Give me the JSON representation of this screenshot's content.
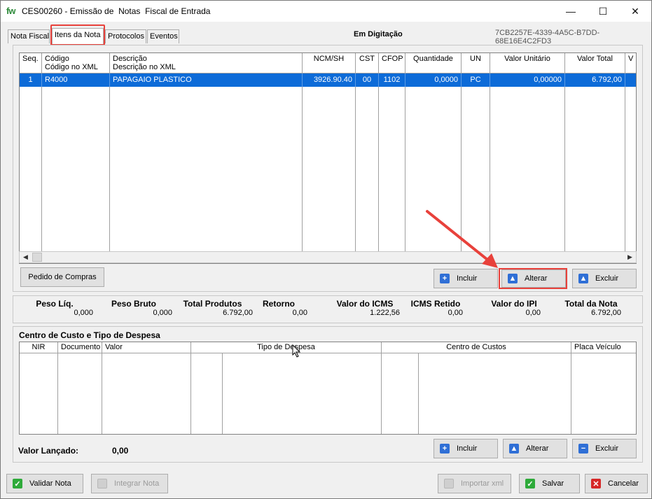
{
  "window": {
    "logo": "fw",
    "title": "CES00260 - Emissão de  Notas  Fiscal de Entrada",
    "minimize": "—",
    "maximize": "☐",
    "close": "✕"
  },
  "tabs": [
    "Nota Fiscal",
    "Itens da Nota",
    "Protocolos",
    "Eventos"
  ],
  "active_tab": "Itens da Nota",
  "status": "Em Digitação",
  "guid": "7CB2257E-4339-4A5C-B7DD-68E16E4C2FD3",
  "items_grid": {
    "headers": [
      {
        "l1": "Seq.",
        "l2": ""
      },
      {
        "l1": "Código",
        "l2": "Código no XML"
      },
      {
        "l1": "Descrição",
        "l2": "Descrição no XML"
      },
      {
        "l1": "NCM/SH",
        "l2": ""
      },
      {
        "l1": "CST",
        "l2": ""
      },
      {
        "l1": "CFOP",
        "l2": ""
      },
      {
        "l1": "Quantidade",
        "l2": ""
      },
      {
        "l1": "UN",
        "l2": ""
      },
      {
        "l1": "Valor Unitário",
        "l2": ""
      },
      {
        "l1": "Valor Total",
        "l2": ""
      },
      {
        "l1": "V",
        "l2": ""
      }
    ],
    "rows": [
      {
        "seq": "1",
        "codigo": "R4000",
        "descricao": "PAPAGAIO PLASTICO",
        "ncm": "3926.90.40",
        "cst": "00",
        "cfop": "1102",
        "quantidade": "0,0000",
        "un": "PC",
        "valor_unitario": "0,00000",
        "valor_total": "6.792,00"
      }
    ]
  },
  "buttons": {
    "pedido_compras": "Pedido de Compras",
    "incluir": "Incluir",
    "alterar": "Alterar",
    "excluir": "Excluir",
    "validar_nota": "Validar Nota",
    "integrar_nota": "Integrar Nota",
    "importar_xml": "Importar xml",
    "salvar": "Salvar",
    "cancelar": "Cancelar"
  },
  "totals": [
    {
      "label": "Peso Líq.",
      "value": "0,000"
    },
    {
      "label": "Peso Bruto",
      "value": "0,000"
    },
    {
      "label": "Total Produtos",
      "value": "6.792,00"
    },
    {
      "label": "Retorno",
      "value": "0,00"
    },
    {
      "label": "Valor do ICMS",
      "value": "1.222,56"
    },
    {
      "label": "ICMS Retido",
      "value": "0,00"
    },
    {
      "label": "Valor do IPI",
      "value": "0,00"
    },
    {
      "label": "Total da Nota",
      "value": "6.792,00"
    }
  ],
  "cost_center": {
    "title": "Centro de Custo e Tipo de Despesa",
    "headers": [
      "NIR",
      "Documento",
      "Valor",
      "Tipo de Despesa",
      "Centro de Custos",
      "Placa Veículo"
    ],
    "valor_lancado_label": "Valor Lançado:",
    "valor_lancado_value": "0,00"
  },
  "colors": {
    "selection": "#0d6bd8",
    "highlight": "#e8413b",
    "icon_blue": "#2f6fd6",
    "icon_green": "#2eaa3a",
    "icon_red": "#d62828"
  }
}
